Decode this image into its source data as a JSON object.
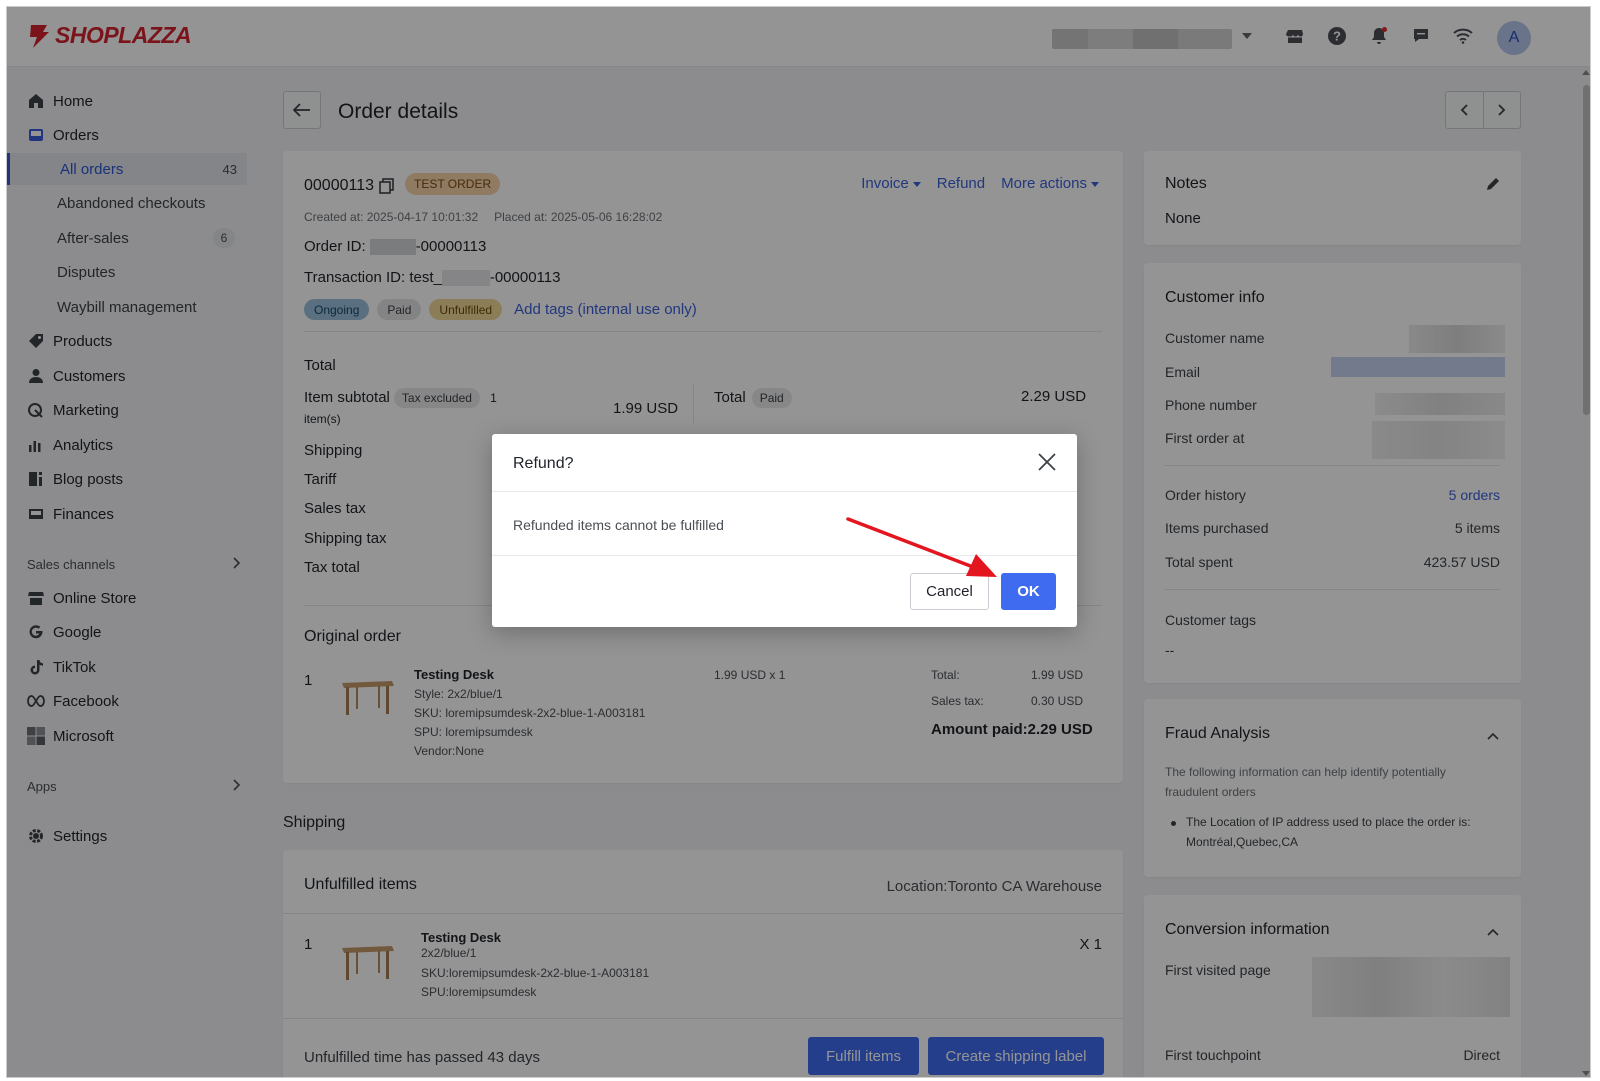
{
  "brand": {
    "name": "SHOPLAZZA"
  },
  "header": {
    "avatar_initial": "A",
    "icons": [
      "store-icon",
      "help-icon",
      "bell-icon",
      "chat-icon",
      "wifi-icon"
    ]
  },
  "sidebar": {
    "items": [
      {
        "label": "Home",
        "icon": "home-icon"
      },
      {
        "label": "Orders",
        "icon": "orders-icon"
      },
      {
        "label": "All orders",
        "badge": "43"
      },
      {
        "label": "Abandoned checkouts"
      },
      {
        "label": "After-sales",
        "badge": "6"
      },
      {
        "label": "Disputes"
      },
      {
        "label": "Waybill management"
      },
      {
        "label": "Products",
        "icon": "tag-icon"
      },
      {
        "label": "Customers",
        "icon": "person-icon"
      },
      {
        "label": "Marketing",
        "icon": "megaphone-icon"
      },
      {
        "label": "Analytics",
        "icon": "bar-chart-icon"
      },
      {
        "label": "Blog posts",
        "icon": "blog-icon"
      },
      {
        "label": "Finances",
        "icon": "finance-icon"
      }
    ],
    "sales_channels_label": "Sales channels",
    "channels": [
      {
        "label": "Online Store",
        "icon": "store-icon"
      },
      {
        "label": "Google",
        "icon": "google-icon"
      },
      {
        "label": "TikTok",
        "icon": "tiktok-icon"
      },
      {
        "label": "Facebook",
        "icon": "meta-icon"
      },
      {
        "label": "Microsoft",
        "icon": "microsoft-icon"
      }
    ],
    "apps_label": "Apps",
    "settings_label": "Settings"
  },
  "page": {
    "title": "Order details"
  },
  "order": {
    "number": "00000113",
    "test_tag": "TEST ORDER",
    "actions": {
      "invoice": "Invoice",
      "refund": "Refund",
      "more": "More actions"
    },
    "created_at": "Created at:  2025-04-17 10:01:32",
    "placed_at": "Placed at:  2025-05-06 16:28:02",
    "order_id_label": "Order ID:",
    "order_id_suffix": "-00000113",
    "transaction_label": "Transaction ID: test_",
    "transaction_suffix": "-00000113",
    "tags": {
      "ongoing": "Ongoing",
      "paid": "Paid",
      "unfulfilled": "Unfulfilled",
      "add": "Add tags (internal use only)"
    }
  },
  "totals": {
    "heading": "Total",
    "item_subtotal_label": "Item subtotal",
    "tax_excluded": "Tax excluded",
    "items_count_a": "1",
    "items_count_b": "item(s)",
    "item_subtotal_value": "1.99 USD",
    "total_label": "Total",
    "total_paid": "Paid",
    "total_value": "2.29 USD",
    "rows": [
      "Shipping",
      "Tariff",
      "Sales tax",
      "Shipping tax",
      "Tax total"
    ]
  },
  "original_order": {
    "title": "Original order",
    "qty": "1",
    "name": "Testing Desk",
    "style": "Style: 2x2/blue/1",
    "sku": "SKU: loremipsumdesk-2x2-blue-1-A003181",
    "spu": "SPU: loremipsumdesk",
    "vendor": "Vendor:None",
    "price_qty": "1.99 USD x 1",
    "total_label": "Total:",
    "total_value": "1.99 USD",
    "sales_tax_label": "Sales tax:",
    "sales_tax_value": "0.30 USD",
    "amount_paid": "Amount paid:2.29 USD"
  },
  "notes": {
    "title": "Notes",
    "value": "None"
  },
  "customer": {
    "title": "Customer info",
    "name_label": "Customer name",
    "email_label": "Email",
    "phone_label": "Phone number",
    "first_order_label": "First order at",
    "history_label": "Order history",
    "history_value": "5 orders",
    "items_label": "Items purchased",
    "items_value": "5 items",
    "spent_label": "Total spent",
    "spent_value": "423.57 USD",
    "tags_label": "Customer tags",
    "tags_value": "--"
  },
  "fraud": {
    "title": "Fraud Analysis",
    "desc_a": "The following information can help identify potentially",
    "desc_b": "fraudulent orders",
    "bullet_a": "The Location of IP address used to place the order is:",
    "bullet_b": "Montréal,Quebec,CA"
  },
  "conversion": {
    "title": "Conversion information",
    "first_page": "First visited page",
    "first_touch": "First touchpoint",
    "first_touch_value": "Direct"
  },
  "shipping": {
    "title": "Shipping",
    "unfulfilled_title": "Unfulfilled items",
    "location": "Location:Toronto CA Warehouse",
    "qty": "1",
    "name": "Testing Desk",
    "variant": "2x2/blue/1",
    "sku": "SKU:loremipsumdesk-2x2-blue-1-A003181",
    "spu": "SPU:loremipsumdesk",
    "count": "X 1",
    "time_passed": "Unfulfilled time has passed 43 days",
    "fulfill_btn": "Fulfill items",
    "label_btn": "Create shipping label"
  },
  "modal": {
    "title": "Refund?",
    "body": "Refunded items cannot be fulfilled",
    "cancel": "Cancel",
    "ok": "OK"
  },
  "colors": {
    "accent": "#3f6bf0",
    "link": "#3b61d9",
    "brand": "#d4232d",
    "annotation_arrow": "#e3151f"
  }
}
